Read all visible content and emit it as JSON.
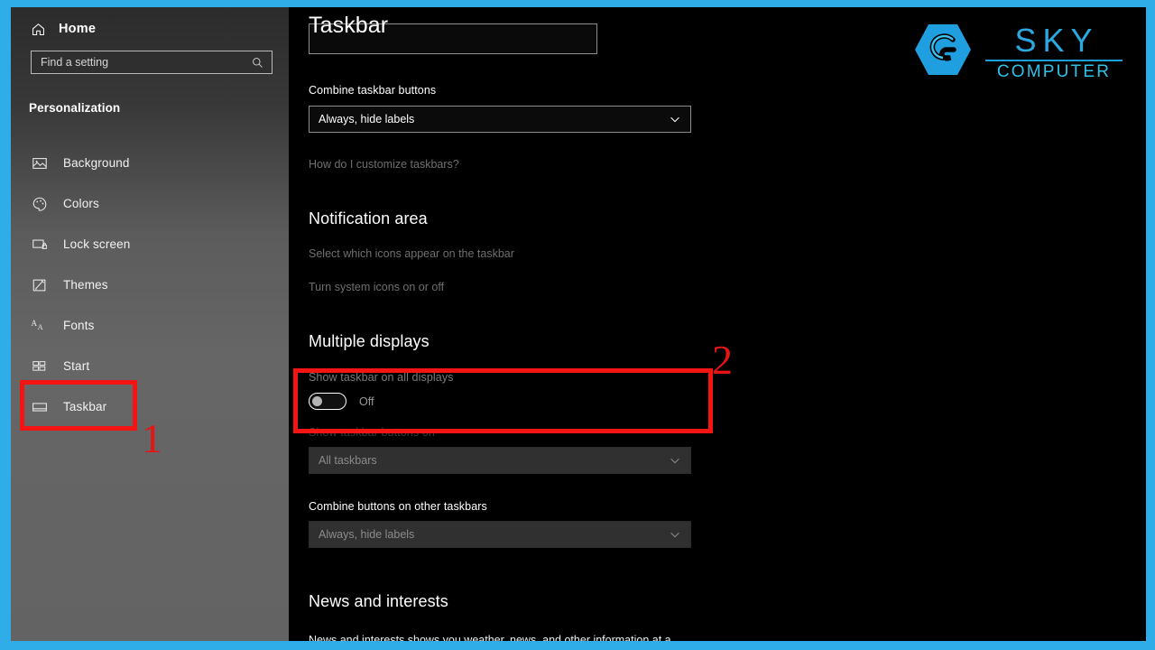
{
  "frame": {
    "accent_color": "#2eade9"
  },
  "sidebar": {
    "home": {
      "label": "Home",
      "icon": "home-icon"
    },
    "search": {
      "placeholder": "Find a setting",
      "value": "",
      "icon": "search-icon"
    },
    "group_title": "Personalization",
    "items": [
      {
        "label": "Background",
        "icon": "picture-icon"
      },
      {
        "label": "Colors",
        "icon": "palette-icon"
      },
      {
        "label": "Lock screen",
        "icon": "lock-screen-icon"
      },
      {
        "label": "Themes",
        "icon": "brush-icon"
      },
      {
        "label": "Fonts",
        "icon": "fonts-icon"
      },
      {
        "label": "Start",
        "icon": "start-grid-icon"
      },
      {
        "label": "Taskbar",
        "icon": "taskbar-icon"
      }
    ]
  },
  "main": {
    "page_title": "Taskbar",
    "combine_taskbar_buttons": {
      "label": "Combine taskbar buttons",
      "value": "Always, hide labels",
      "chevron": "chevron-down-icon"
    },
    "customize_link": "How do I customize taskbars?",
    "notification_area": {
      "heading": "Notification area",
      "links": [
        "Select which icons appear on the taskbar",
        "Turn system icons on or off"
      ]
    },
    "multiple_displays": {
      "heading": "Multiple displays",
      "show_taskbar_all": {
        "label": "Show taskbar on all displays",
        "state": "Off"
      },
      "show_taskbar_buttons_on": {
        "label": "Show taskbar buttons on",
        "value": "All taskbars",
        "chevron": "chevron-down-icon"
      },
      "combine_other_taskbars": {
        "label": "Combine buttons on other taskbars",
        "value": "Always, hide labels",
        "chevron": "chevron-down-icon"
      }
    },
    "news_and_interests": {
      "heading": "News and interests",
      "description": "News and interests shows you weather, news, and other information at a"
    }
  },
  "logo": {
    "primary": "SKY",
    "secondary": "COMPUTER",
    "mark": "sky-hex-s-icon",
    "primary_color": "#2aa8e0",
    "secondary_color": "#2fc2e8"
  },
  "annotations": {
    "step_one": "1",
    "step_two": "2",
    "color": "#e81313"
  }
}
